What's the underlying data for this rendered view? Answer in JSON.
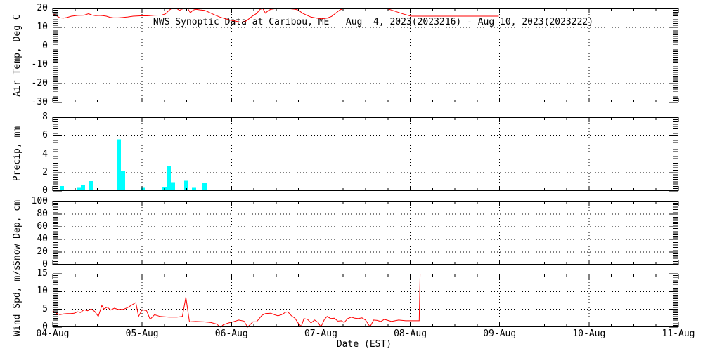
{
  "title": "NWS Synoptic Data at Caribou, ME   Aug  4, 2023(2023216) - Aug 10, 2023(2023222)",
  "xlabel": "Date (EST)",
  "colors": {
    "line": "#ff0000",
    "bar": "#00ffff",
    "axis": "#000000",
    "background": "#ffffff"
  },
  "x_axis": {
    "tick_labels": [
      "04-Aug",
      "05-Aug",
      "06-Aug",
      "07-Aug",
      "08-Aug",
      "09-Aug",
      "10-Aug",
      "11-Aug"
    ],
    "range_days": [
      0,
      7
    ],
    "major_step_days": 1,
    "minor_step_days": 0.25
  },
  "chart_data": [
    {
      "name": "air-temp",
      "type": "line",
      "ylabel": "Air Temp, Deg C",
      "ylim": [
        -30,
        20
      ],
      "yticks": [
        -30,
        -20,
        -10,
        0,
        10,
        20
      ],
      "minor_step": 1,
      "grid": true,
      "series": [
        [
          0,
          17.2
        ],
        [
          0.04,
          16.2
        ],
        [
          0.08,
          15.0
        ],
        [
          0.12,
          14.9
        ],
        [
          0.16,
          15.2
        ],
        [
          0.21,
          15.9
        ],
        [
          0.28,
          16.3
        ],
        [
          0.35,
          16.4
        ],
        [
          0.4,
          17.2
        ],
        [
          0.44,
          16.5
        ],
        [
          0.48,
          16.2
        ],
        [
          0.52,
          16.3
        ],
        [
          0.56,
          16.2
        ],
        [
          0.6,
          15.9
        ],
        [
          0.64,
          15.3
        ],
        [
          0.68,
          15.0
        ],
        [
          0.73,
          15.0
        ],
        [
          0.78,
          15.2
        ],
        [
          0.84,
          15.5
        ],
        [
          0.9,
          15.9
        ],
        [
          0.98,
          16.1
        ],
        [
          1.06,
          16.1
        ],
        [
          1.14,
          16.4
        ],
        [
          1.22,
          16.5
        ],
        [
          1.26,
          17.1
        ],
        [
          1.3,
          18.9
        ],
        [
          1.33,
          20.3
        ],
        [
          1.37,
          20.3
        ],
        [
          1.39,
          19.9
        ],
        [
          1.42,
          18.9
        ],
        [
          1.44,
          19.6
        ],
        [
          1.47,
          20.2
        ],
        [
          1.51,
          20.2
        ],
        [
          1.54,
          17.7
        ],
        [
          1.57,
          19.1
        ],
        [
          1.6,
          19.5
        ],
        [
          1.65,
          19.2
        ],
        [
          1.7,
          19.0
        ],
        [
          1.75,
          17.9
        ],
        [
          1.81,
          16.6
        ],
        [
          1.87,
          15.4
        ],
        [
          1.93,
          14.5
        ],
        [
          1.99,
          13.7
        ],
        [
          2.04,
          13.3
        ],
        [
          2.1,
          12.7
        ],
        [
          2.15,
          12.9
        ],
        [
          2.18,
          13.9
        ],
        [
          2.23,
          15.8
        ],
        [
          2.28,
          17.3
        ],
        [
          2.32,
          19.5
        ],
        [
          2.35,
          20.1
        ],
        [
          2.38,
          17.5
        ],
        [
          2.41,
          18.8
        ],
        [
          2.44,
          19.5
        ],
        [
          2.48,
          19.8
        ],
        [
          2.55,
          20.0
        ],
        [
          2.6,
          19.9
        ],
        [
          2.66,
          19.8
        ],
        [
          2.71,
          19.6
        ],
        [
          2.75,
          19.1
        ],
        [
          2.79,
          17.6
        ],
        [
          2.84,
          16.4
        ],
        [
          2.89,
          15.4
        ],
        [
          2.95,
          14.9
        ],
        [
          3.01,
          14.5
        ],
        [
          3.07,
          14.9
        ],
        [
          3.12,
          15.8
        ],
        [
          3.17,
          17.6
        ],
        [
          3.21,
          19.1
        ],
        [
          3.25,
          20.2
        ],
        [
          3.35,
          20.4
        ],
        [
          3.5,
          20.5
        ],
        [
          3.62,
          20.4
        ],
        [
          3.7,
          20.2
        ],
        [
          3.74,
          19.9
        ],
        [
          3.8,
          19.0
        ],
        [
          3.92,
          17.1
        ],
        [
          4.01,
          15.9
        ],
        [
          4.3,
          15.9
        ],
        [
          4.6,
          15.9
        ],
        [
          4.99,
          15.9
        ]
      ]
    },
    {
      "name": "precip",
      "type": "bar",
      "ylabel": "Precip, mm",
      "ylim": [
        0,
        8
      ],
      "yticks": [
        0,
        2,
        4,
        6,
        8
      ],
      "minor_step": 0.25,
      "grid": true,
      "bar_width_days": 0.047,
      "bars": [
        [
          0.079,
          0.55
        ],
        [
          0.22,
          0.1
        ],
        [
          0.267,
          0.35
        ],
        [
          0.315,
          0.65
        ],
        [
          0.409,
          1.05
        ],
        [
          0.456,
          0.1
        ],
        [
          0.716,
          5.6
        ],
        [
          0.763,
          2.2
        ],
        [
          0.983,
          0.33
        ],
        [
          1.03,
          0.1
        ],
        [
          1.227,
          0.4
        ],
        [
          1.274,
          2.7
        ],
        [
          1.321,
          0.95
        ],
        [
          1.471,
          1.1
        ],
        [
          1.557,
          0.35
        ],
        [
          1.675,
          0.9
        ]
      ]
    },
    {
      "name": "snow-depth",
      "type": "line",
      "ylabel": "Snow Dep, cm",
      "ylim": [
        0,
        100
      ],
      "yticks": [
        0,
        20,
        40,
        60,
        80,
        100
      ],
      "minor_step": 2.5,
      "grid": true,
      "series": []
    },
    {
      "name": "wind-speed",
      "type": "line",
      "ylabel": "Wind Spd, m/s",
      "ylim": [
        0,
        15
      ],
      "yticks": [
        0,
        5,
        10,
        15
      ],
      "minor_step": 0.5,
      "grid": true,
      "series": [
        [
          0,
          4.5
        ],
        [
          0.04,
          3.9
        ],
        [
          0.08,
          3.5
        ],
        [
          0.12,
          3.7
        ],
        [
          0.16,
          3.8
        ],
        [
          0.2,
          3.8
        ],
        [
          0.24,
          3.9
        ],
        [
          0.28,
          4.3
        ],
        [
          0.31,
          4.1
        ],
        [
          0.35,
          4.9
        ],
        [
          0.39,
          4.6
        ],
        [
          0.43,
          5.1
        ],
        [
          0.47,
          4.4
        ],
        [
          0.51,
          3.0
        ],
        [
          0.55,
          6.1
        ],
        [
          0.57,
          5.1
        ],
        [
          0.61,
          5.6
        ],
        [
          0.65,
          4.8
        ],
        [
          0.69,
          5.3
        ],
        [
          0.73,
          5.0
        ],
        [
          0.79,
          5.0
        ],
        [
          0.84,
          5.5
        ],
        [
          0.89,
          6.3
        ],
        [
          0.93,
          6.9
        ],
        [
          0.96,
          3.0
        ],
        [
          1.0,
          4.9
        ],
        [
          1.05,
          4.6
        ],
        [
          1.09,
          2.2
        ],
        [
          1.14,
          3.5
        ],
        [
          1.2,
          3.0
        ],
        [
          1.3,
          2.8
        ],
        [
          1.39,
          2.8
        ],
        [
          1.45,
          3.0
        ],
        [
          1.49,
          8.4
        ],
        [
          1.53,
          1.5
        ],
        [
          1.6,
          1.6
        ],
        [
          1.69,
          1.5
        ],
        [
          1.77,
          1.3
        ],
        [
          1.83,
          0.9
        ],
        [
          1.88,
          0.0
        ],
        [
          1.91,
          0.7
        ],
        [
          1.97,
          1.2
        ],
        [
          2.02,
          1.5
        ],
        [
          2.08,
          2.0
        ],
        [
          2.14,
          1.7
        ],
        [
          2.18,
          0.0
        ],
        [
          2.24,
          1.5
        ],
        [
          2.28,
          1.5
        ],
        [
          2.34,
          3.3
        ],
        [
          2.38,
          3.8
        ],
        [
          2.44,
          3.9
        ],
        [
          2.48,
          3.5
        ],
        [
          2.52,
          3.2
        ],
        [
          2.56,
          3.5
        ],
        [
          2.6,
          4.1
        ],
        [
          2.63,
          4.3
        ],
        [
          2.67,
          3.2
        ],
        [
          2.71,
          2.5
        ],
        [
          2.75,
          1.0
        ],
        [
          2.78,
          0.2
        ],
        [
          2.81,
          2.4
        ],
        [
          2.85,
          2.2
        ],
        [
          2.89,
          1.2
        ],
        [
          2.93,
          2.0
        ],
        [
          2.97,
          1.3
        ],
        [
          3.0,
          0.0
        ],
        [
          3.04,
          2.2
        ],
        [
          3.07,
          3.0
        ],
        [
          3.11,
          2.4
        ],
        [
          3.15,
          2.5
        ],
        [
          3.19,
          1.7
        ],
        [
          3.23,
          1.8
        ],
        [
          3.26,
          1.3
        ],
        [
          3.3,
          2.4
        ],
        [
          3.34,
          2.8
        ],
        [
          3.38,
          2.5
        ],
        [
          3.42,
          2.4
        ],
        [
          3.46,
          2.6
        ],
        [
          3.5,
          2.0
        ],
        [
          3.55,
          0.1
        ],
        [
          3.59,
          2.0
        ],
        [
          3.63,
          1.9
        ],
        [
          3.67,
          1.6
        ],
        [
          3.71,
          2.2
        ],
        [
          3.75,
          1.9
        ],
        [
          3.79,
          1.6
        ],
        [
          3.83,
          1.8
        ],
        [
          3.87,
          2.0
        ],
        [
          3.91,
          1.9
        ],
        [
          3.95,
          1.8
        ],
        [
          4.0,
          1.8
        ],
        [
          4.06,
          1.8
        ],
        [
          4.1,
          1.8
        ],
        [
          4.11,
          15.2
        ]
      ]
    }
  ]
}
